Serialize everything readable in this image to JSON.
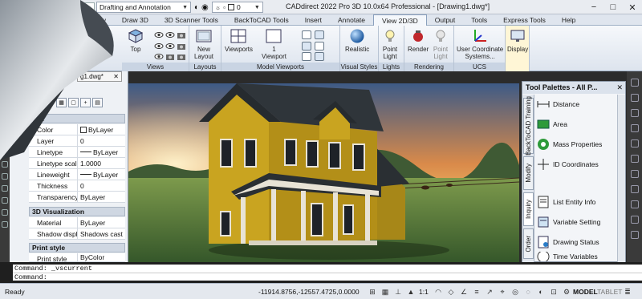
{
  "titlebar": {
    "workspace": "Drafting and Annotation",
    "layer_value": "0",
    "app_title": "CADdirect 2022 Pro 3D 10.0x64 Professional - [Drawing1.dwg*]",
    "minimize": "−",
    "maximize": "□",
    "close": "✕"
  },
  "tabs": [
    {
      "label": "Draw"
    },
    {
      "label": "Draw 3D"
    },
    {
      "label": "3D Scanner Tools"
    },
    {
      "label": "BackToCAD Tools"
    },
    {
      "label": "Insert"
    },
    {
      "label": "Annotate"
    },
    {
      "label": "View 2D/3D"
    },
    {
      "label": "Output"
    },
    {
      "label": "Tools"
    },
    {
      "label": "Express Tools"
    },
    {
      "label": "Help"
    }
  ],
  "ribbon": {
    "views": {
      "top_label": "Top",
      "group": "Views"
    },
    "layouts": {
      "new_layout": "New\nLayout",
      "group": "Layouts"
    },
    "model_viewports": {
      "viewports": "Viewports",
      "one_viewport": "1\nViewport",
      "group": "Model Viewports"
    },
    "visual_styles": {
      "realistic": "Realistic",
      "group": "Visual Styles"
    },
    "lights": {
      "point_light": "Point\nLight",
      "group": "Lights"
    },
    "rendering": {
      "render": "Render",
      "point_light2": "Point\nLight",
      "group": "Rendering"
    },
    "ucs": {
      "ucs": "User Coordinate\nSystems...",
      "group": "UCS"
    },
    "display": {
      "label": "Display"
    },
    "fragment": "bit"
  },
  "document": {
    "tab": "g1.dwg*"
  },
  "properties": {
    "general_header": "eral",
    "rows": [
      {
        "key": "Color",
        "value": "ByLayer"
      },
      {
        "key": "Layer",
        "value": "0"
      },
      {
        "key": "Linetype",
        "value": "ByLayer"
      },
      {
        "key": "Linetype scale",
        "value": "1.0000"
      },
      {
        "key": "Lineweight",
        "value": "ByLayer"
      },
      {
        "key": "Thickness",
        "value": "0"
      },
      {
        "key": "Transparency",
        "value": "ByLayer"
      }
    ],
    "viz_header": "3D Visualization",
    "viz_rows": [
      {
        "key": "Material",
        "value": "ByLayer"
      },
      {
        "key": "Shadow display",
        "value": "Shadows cast ..."
      }
    ],
    "print_header": "Print style",
    "print_rows": [
      {
        "key": "Print style",
        "value": "ByColor"
      }
    ]
  },
  "palette": {
    "title": "Tool Palettes - All P...",
    "tabs": [
      {
        "label": "BackToCAD Training"
      },
      {
        "label": "Modify"
      },
      {
        "label": "Inquiry"
      },
      {
        "label": "Order"
      }
    ],
    "tools": [
      {
        "label": "Distance"
      },
      {
        "label": "Area"
      },
      {
        "label": "Mass Properties"
      },
      {
        "label": "ID Coordinates"
      },
      {
        "label": "List Entity Info"
      },
      {
        "label": "Variable Setting"
      },
      {
        "label": "Drawing Status"
      },
      {
        "label": "Time Variables"
      }
    ]
  },
  "command": {
    "line1": "Command: _vscurrent",
    "line2": "Command:"
  },
  "statusbar": {
    "ready": "Ready",
    "coords": "-11914.8756,-12557.4725,0.0000",
    "scale": "1:1",
    "model": "MODEL",
    "tablet": "TABLET"
  },
  "colors": {
    "house_wall": "#c9a420",
    "roof": "#2a2f33",
    "trim": "#e8e3d6",
    "sky": "#f0a24a",
    "grass": "#5e8a3c"
  }
}
